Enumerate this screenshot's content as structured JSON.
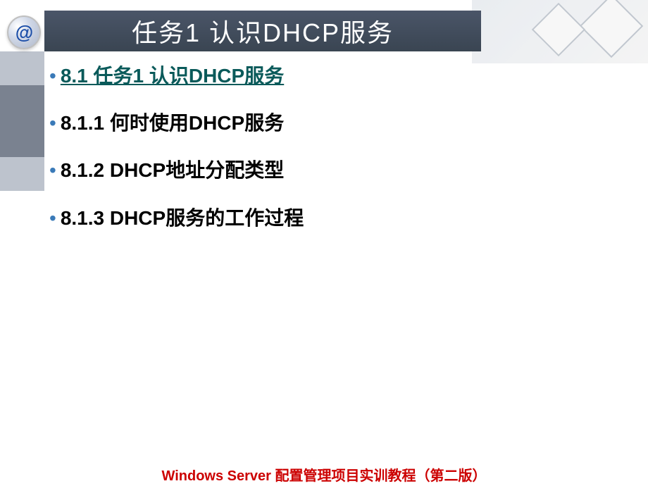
{
  "header": {
    "at_symbol": "@",
    "title": "任务1   认识DHCP服务"
  },
  "content": {
    "items": [
      {
        "text": "8.1 任务1 认识DHCP服务",
        "is_link": true
      },
      {
        "text": "8.1.1  何时使用DHCP服务",
        "is_link": false
      },
      {
        "text": "8.1.2  DHCP地址分配类型",
        "is_link": false
      },
      {
        "text": "8.1.3  DHCP服务的工作过程",
        "is_link": false
      }
    ]
  },
  "footer": {
    "text": "Windows Server 配置管理项目实训教程（第二版）"
  }
}
